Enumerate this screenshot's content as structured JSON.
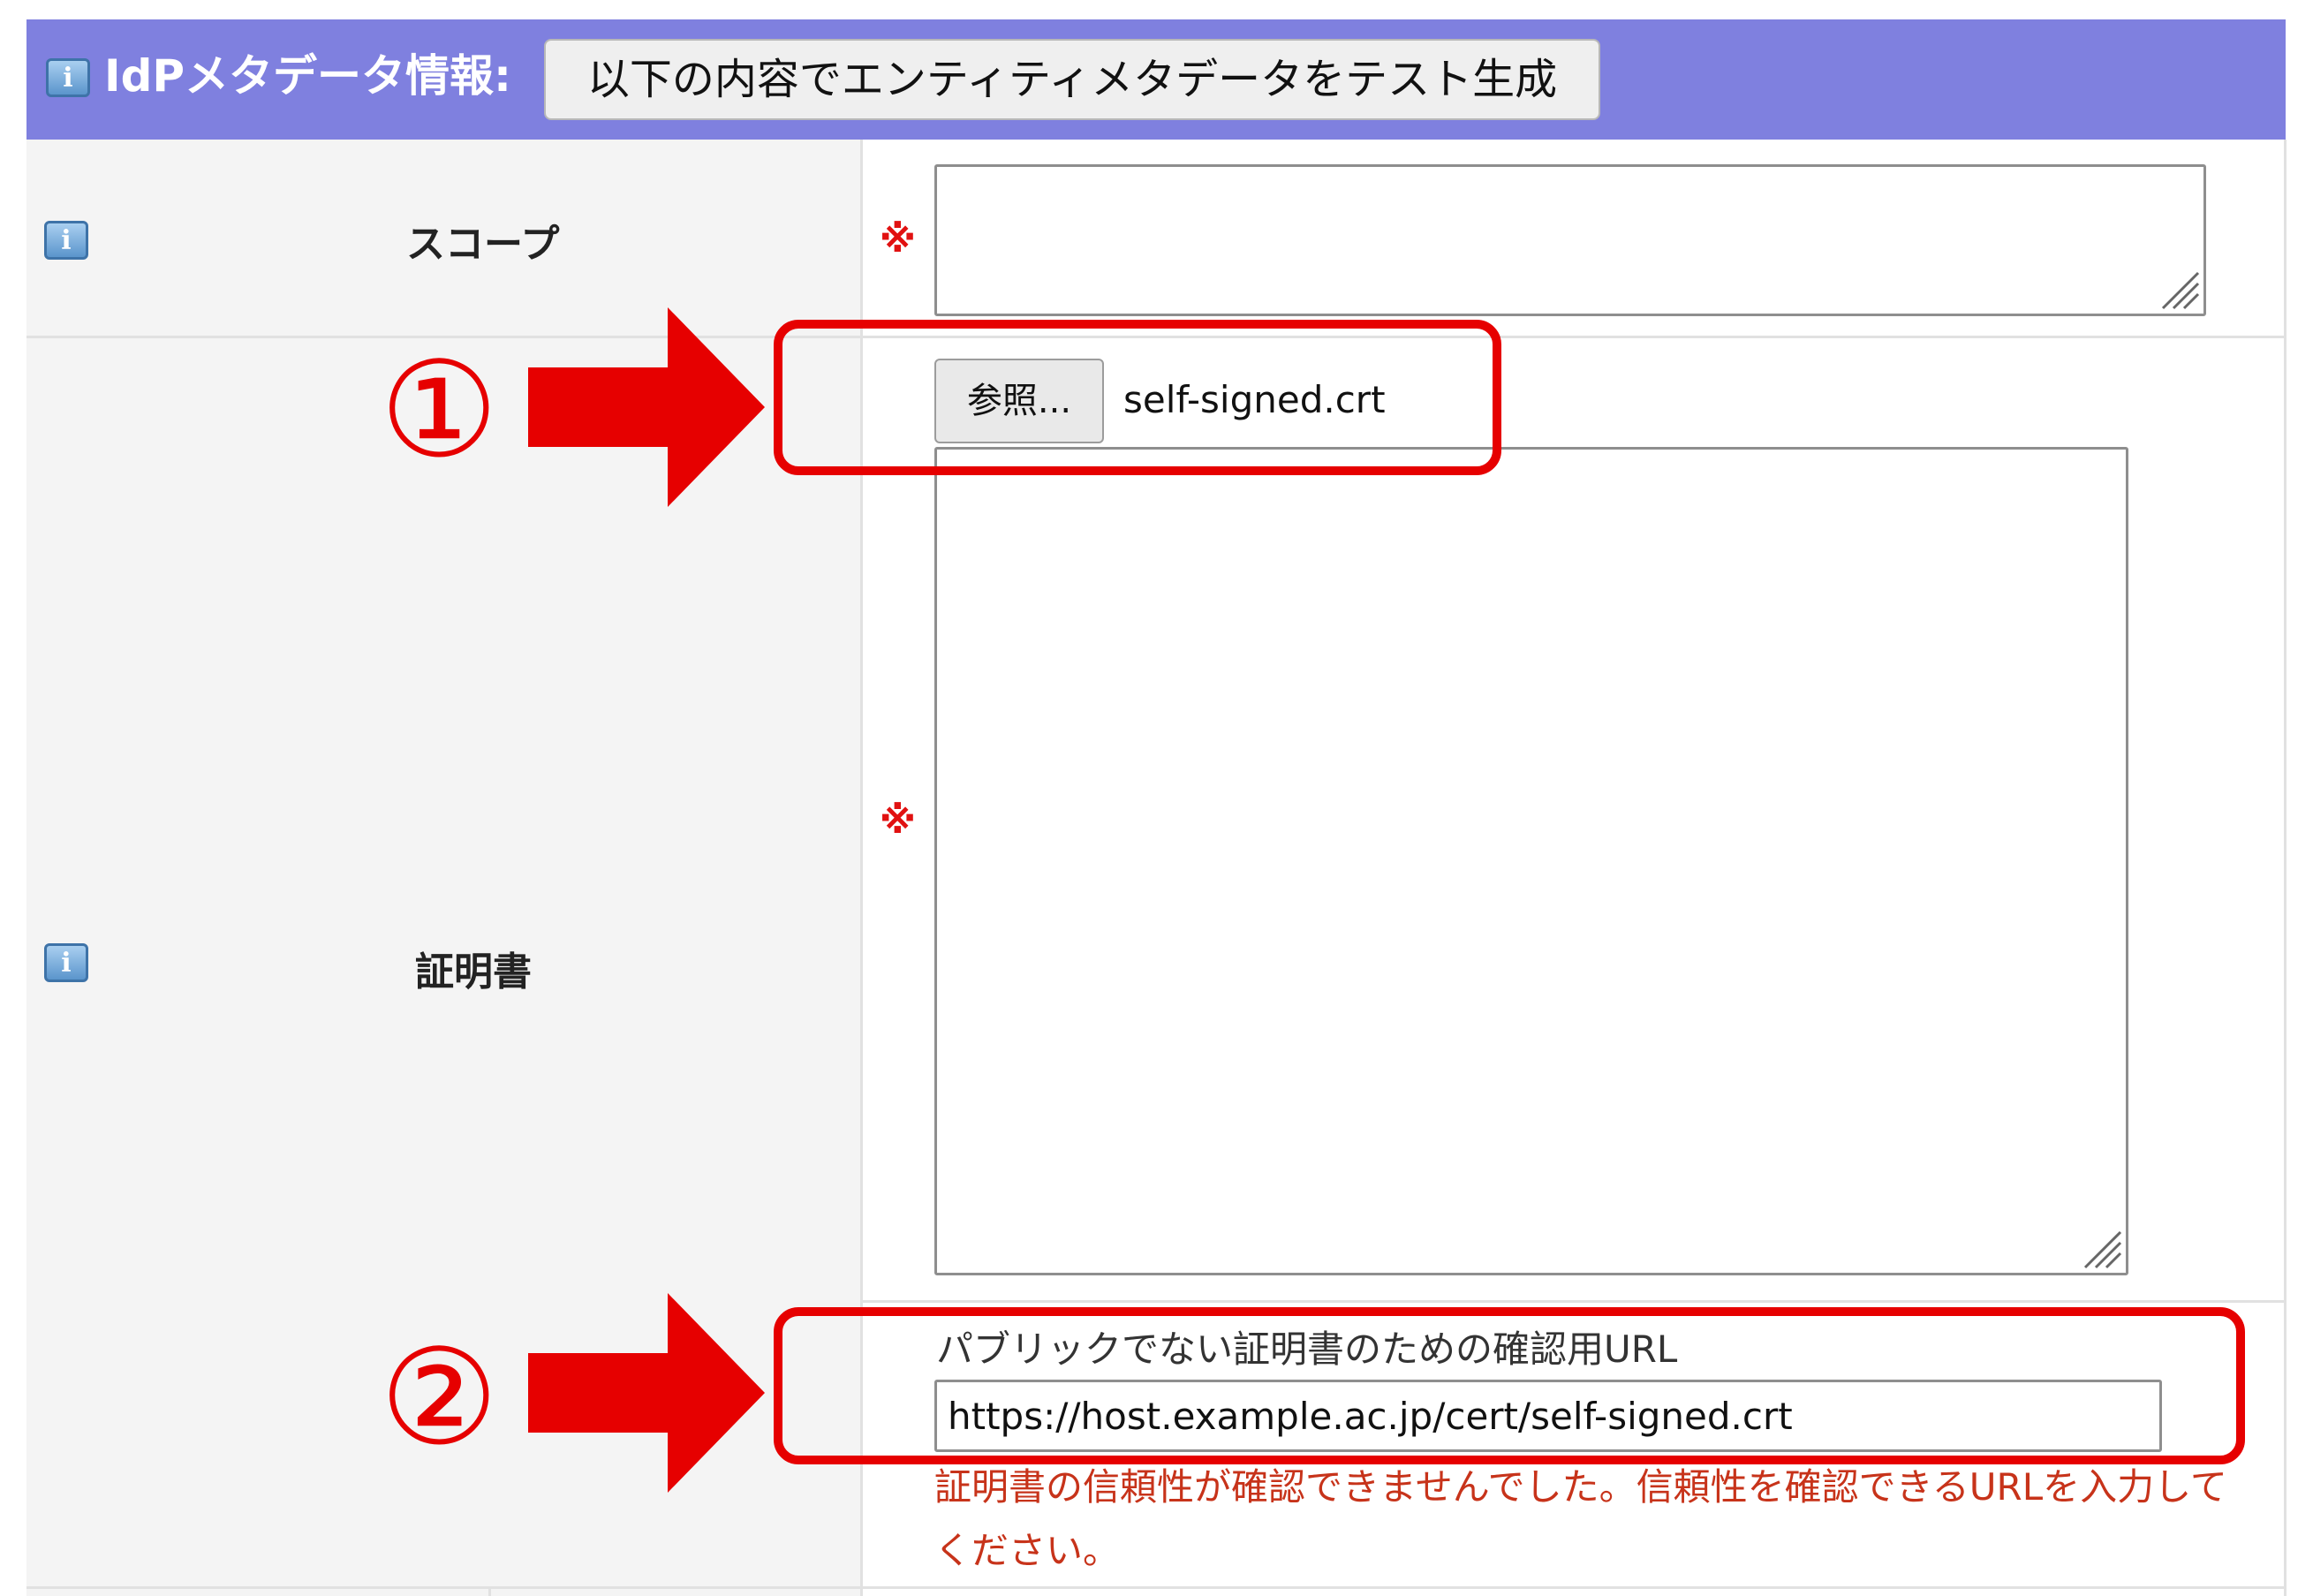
{
  "header": {
    "title": "IdPメタデータ情報:",
    "generate_button": "以下の内容でエンティティメタデータをテスト生成"
  },
  "scope_field": {
    "label": "スコープ",
    "required_mark": "※",
    "value": ""
  },
  "certificate_field": {
    "label": "証明書",
    "required_mark": "※",
    "browse_button": "参照...",
    "file_name": "self-signed.crt",
    "value": "",
    "url_label": "パブリックでない証明書のための確認用URL",
    "url_value": "https://host.example.ac.jp/cert/self-signed.crt",
    "error_message": "証明書の信頼性が確認できませんでした。信頼性を確認できるURLを入力してください。"
  },
  "annotations": {
    "step1": "①",
    "step2": "②"
  },
  "colors": {
    "header_bg": "#7f80df",
    "annotation_red": "#e60000",
    "required_red": "#e11111",
    "error_text": "#c7331a",
    "label_column_bg": "#f4f4f4"
  },
  "icons": [
    "info-icon",
    "resize-grip-icon",
    "arrow-right-icon"
  ]
}
